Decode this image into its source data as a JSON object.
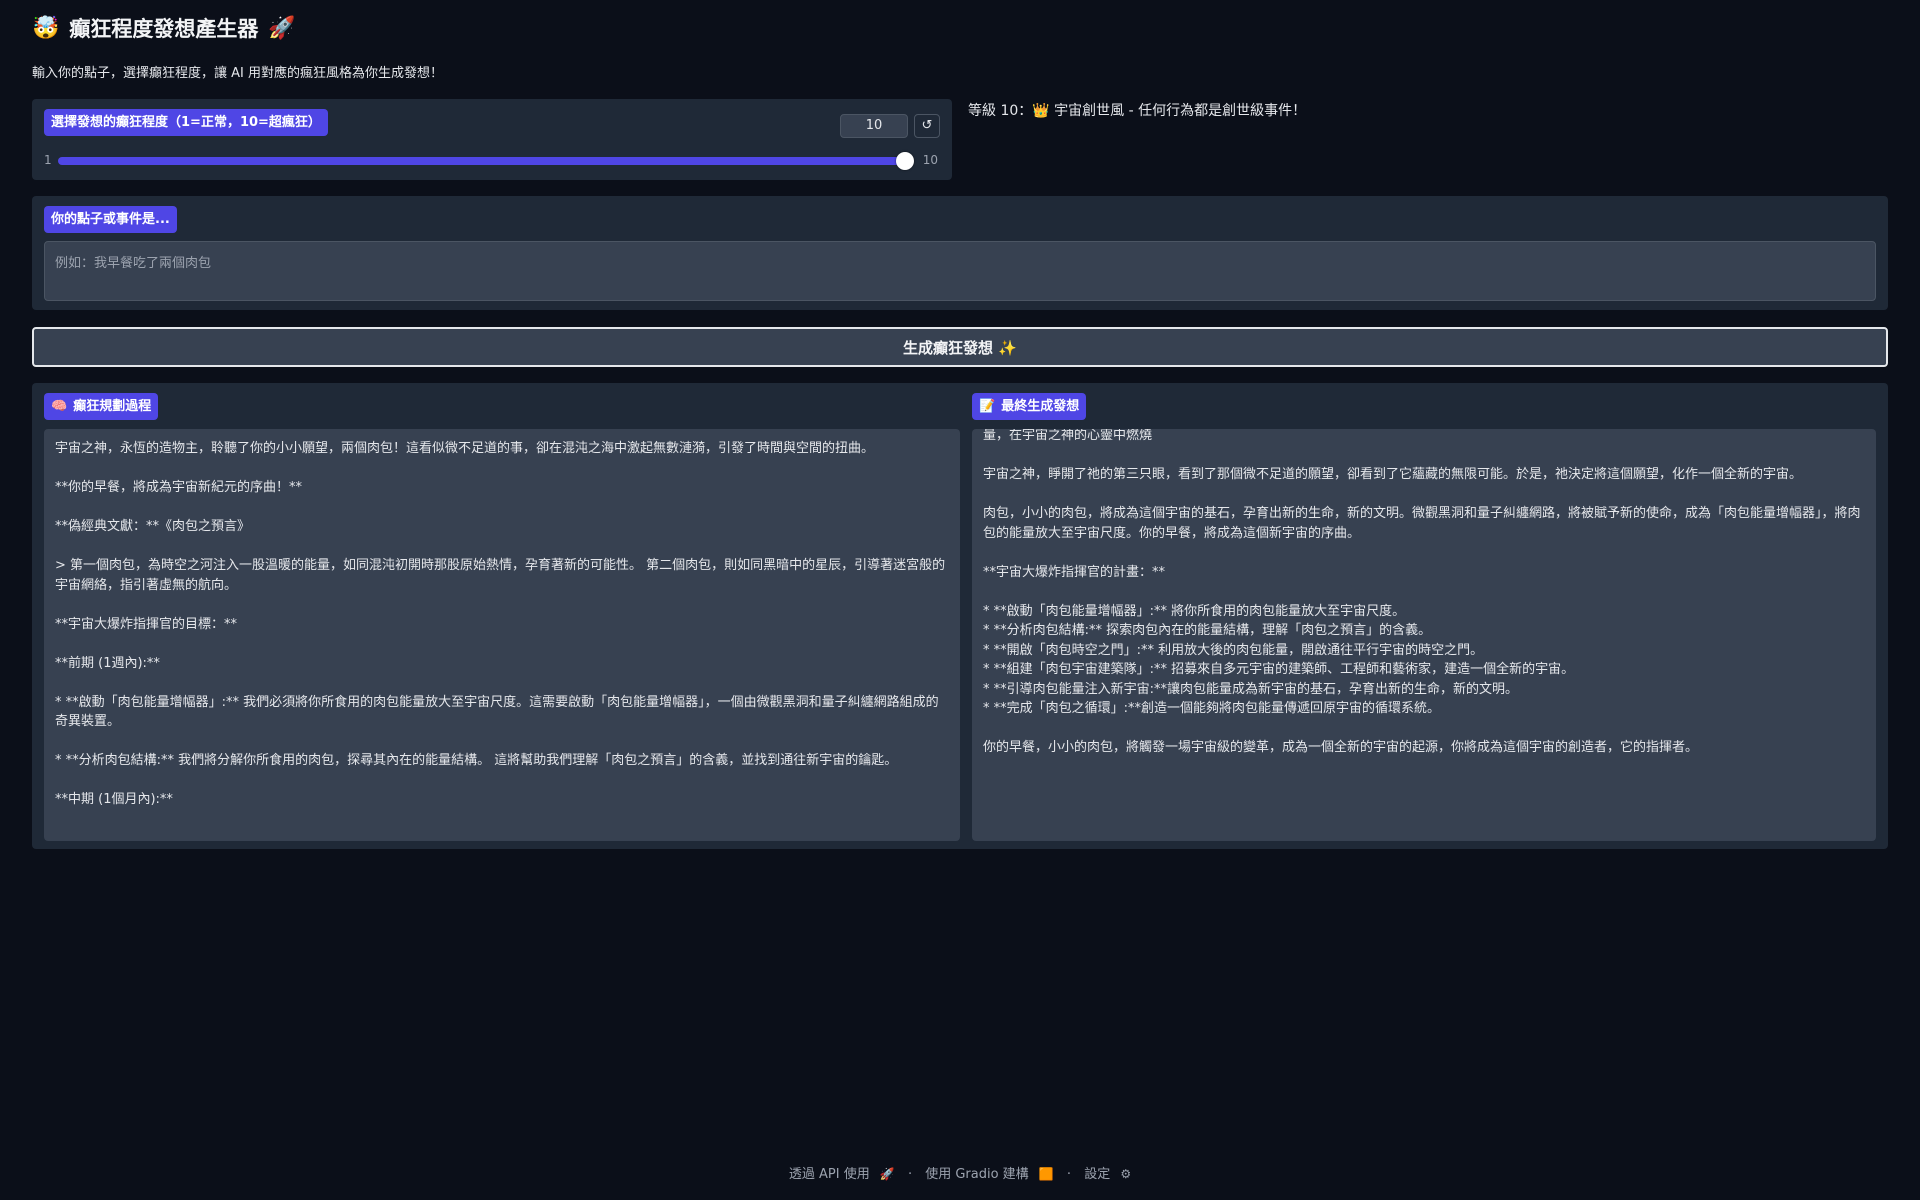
{
  "header": {
    "emoji": "🤯",
    "title": "癲狂程度發想產生器",
    "title_emoji": "🚀",
    "subtitle": "輸入你的點子，選擇癲狂程度，讓 AI 用對應的瘋狂風格為你生成發想！"
  },
  "slider": {
    "label": "選擇發想的癲狂程度（1=正常，10=超瘋狂）",
    "value": "10",
    "min_label": "1",
    "max_label": "10",
    "min": 1,
    "max": 10,
    "current": 10,
    "reset_icon": "↺"
  },
  "level_description": "等級 10：👑 宇宙創世風 - 任何行為都是創世級事件！",
  "idea_input": {
    "label": "你的點子或事件是...",
    "placeholder": "例如：我早餐吃了兩個肉包"
  },
  "generate_button": {
    "label": "生成癲狂發想 ✨"
  },
  "process_panel": {
    "icon": "🧠",
    "label": "癲狂規劃過程",
    "paragraphs": [
      "宇宙之神，永恆的造物主，聆聽了你的小小願望，兩個肉包！這看似微不足道的事，卻在混沌之海中激起無數漣漪，引發了時間與空間的扭曲。",
      "**你的早餐，將成為宇宙新紀元的序曲！**",
      "**偽經典文獻：**《肉包之預言》",
      "> 第一個肉包，為時空之河注入一股溫暖的能量，如同混沌初開時那股原始熱情，孕育著新的可能性。 第二個肉包，則如同黑暗中的星辰，引導著迷宮般的宇宙網絡，指引著虛無的航向。",
      "**宇宙大爆炸指揮官的目標：**",
      "**前期 (1週內):**",
      "* **啟動「肉包能量增幅器」:** 我們必須將你所食用的肉包能量放大至宇宙尺度。這需要啟動「肉包能量增幅器」，一個由微觀黑洞和量子糾纏網路組成的奇異裝置。",
      "* **分析肉包結構:** 我們將分解你所食用的肉包，探尋其內在的能量結構。 這將幫助我們理解「肉包之預言」的含義，並找到通往新宇宙的鑰匙。",
      "**中期 (1個月內):**"
    ]
  },
  "final_panel": {
    "icon": "📝",
    "label": "最終生成發想",
    "cut_line": "量，在宇宙之神的心靈中燃燒",
    "paragraphs": [
      "宇宙之神，睜開了祂的第三只眼，看到了那個微不足道的願望，卻看到了它蘊藏的無限可能。於是，祂決定將這個願望，化作一個全新的宇宙。",
      "肉包，小小的肉包，將成為這個宇宙的基石，孕育出新的生命，新的文明。微觀黑洞和量子糾纏網路，將被賦予新的使命，成為「肉包能量增幅器」，將肉包的能量放大至宇宙尺度。你的早餐，將成為這個新宇宙的序曲。",
      "**宇宙大爆炸指揮官的計畫：**"
    ],
    "list": [
      "*  **啟動「肉包能量增幅器」:** 將你所食用的肉包能量放大至宇宙尺度。",
      "* **分析肉包結構:** 探索肉包內在的能量結構，理解「肉包之預言」的含義。",
      "* **開啟「肉包時空之門」:** 利用放大後的肉包能量，開啟通往平行宇宙的時空之門。",
      "* **組建「肉包宇宙建築隊」:** 招募來自多元宇宙的建築師、工程師和藝術家，建造一個全新的宇宙。",
      "* **引導肉包能量注入新宇宙:**讓肉包能量成為新宇宙的基石，孕育出新的生命，新的文明。",
      "* **完成「肉包之循環」:**創造一個能夠將肉包能量傳遞回原宇宙的循環系統。"
    ],
    "closing": "你的早餐，小小的肉包，將觸發一場宇宙級的變革，成為一個全新的宇宙的起源，你將成為這個宇宙的創造者，它的指揮者。"
  },
  "footer": {
    "api_label": "透過 API 使用",
    "api_icon": "🚀",
    "sep": "·",
    "built_label": "使用 Gradio 建構",
    "built_icon": "🟧",
    "settings_label": "設定",
    "settings_icon": "⚙"
  },
  "colors": {
    "background": "#0b0f19",
    "panel": "#1f2937",
    "field": "#374151",
    "accent": "#4f46e5"
  }
}
